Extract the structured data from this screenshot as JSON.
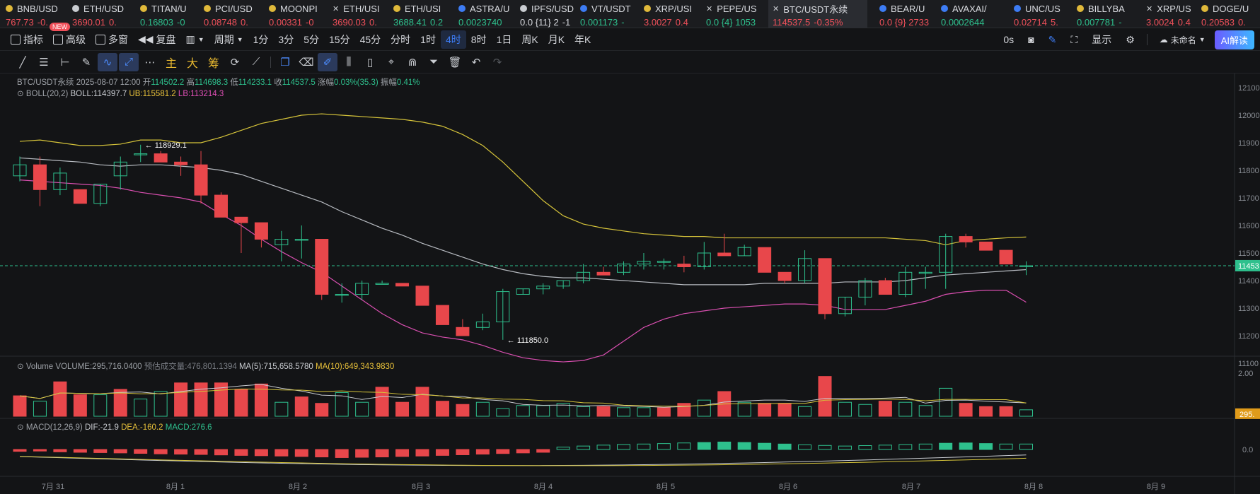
{
  "tickers": [
    {
      "sym": "BNB/USD",
      "icon": "coin-icon",
      "color": "#e0b93a",
      "val": "767.73",
      "chg": "-0.",
      "dir": "neg"
    },
    {
      "sym": "ETH/USD",
      "icon": "coin-icon",
      "color": "#c9ccd1",
      "val": "3690.01",
      "chg": "0.",
      "dir": "neg"
    },
    {
      "sym": "TITAN/U",
      "icon": "coin-icon",
      "color": "#e0b93a",
      "val": "0.16803",
      "chg": "-0",
      "dir": "pos"
    },
    {
      "sym": "PCI/USD",
      "icon": "coin-icon",
      "color": "#e0b93a",
      "val": "0.08748",
      "chg": "0.",
      "dir": "neg"
    },
    {
      "sym": "MOONPI",
      "icon": "coin-icon",
      "color": "#e0b93a",
      "val": "0.00331",
      "chg": "-0",
      "dir": "neg"
    },
    {
      "sym": "ETH/USI",
      "icon": "close-icon",
      "color": "#c9ccd1",
      "val": "3690.03",
      "chg": "0.",
      "dir": "neg"
    },
    {
      "sym": "ETH/USI",
      "icon": "coin-icon",
      "color": "#e0b93a",
      "val": "3688.41",
      "chg": "0.2",
      "dir": "pos"
    },
    {
      "sym": "ASTRA/U",
      "icon": "coin-icon",
      "color": "#3d7cf4",
      "val": "0.0023740",
      "chg": "",
      "dir": "pos"
    },
    {
      "sym": "IPFS/USD",
      "icon": "coin-icon",
      "color": "#c9ccd1",
      "val": "0.0 {11} 2",
      "chg": "-1",
      "dir": "neutral"
    },
    {
      "sym": "VT/USDT",
      "icon": "coin-icon",
      "color": "#3d7cf4",
      "val": "0.001173",
      "chg": "-",
      "dir": "pos"
    },
    {
      "sym": "XRP/USI",
      "icon": "coin-icon",
      "color": "#e0b93a",
      "val": "3.0027",
      "chg": "0.4",
      "dir": "neg"
    },
    {
      "sym": "PEPE/US",
      "icon": "close-icon",
      "color": "#c9ccd1",
      "val": "0.0 {4} 1053",
      "chg": "",
      "dir": "pos"
    },
    {
      "sym": "BTC/USDT永续",
      "icon": "close-icon",
      "color": "#c9ccd1",
      "val": "114537.5",
      "chg": "-0.35%",
      "dir": "neg"
    },
    {
      "sym": "BEAR/U",
      "icon": "coin-icon",
      "color": "#3d7cf4",
      "val": "0.0 {9} 2733",
      "chg": "",
      "dir": "neg"
    },
    {
      "sym": "AVAXAI/",
      "icon": "coin-icon",
      "color": "#3d7cf4",
      "val": "0.0002644",
      "chg": "",
      "dir": "pos"
    },
    {
      "sym": "UNC/US",
      "icon": "coin-icon",
      "color": "#3d7cf4",
      "val": "0.02714",
      "chg": "5.",
      "dir": "neg"
    },
    {
      "sym": "BILLYBA",
      "icon": "coin-icon",
      "color": "#e0b93a",
      "val": "0.007781",
      "chg": "-",
      "dir": "pos"
    },
    {
      "sym": "XRP/US",
      "icon": "close-icon",
      "color": "#c9ccd1",
      "val": "3.0024",
      "chg": "0.4",
      "dir": "neg"
    },
    {
      "sym": "DOGE/U",
      "icon": "coin-icon",
      "color": "#e0b93a",
      "val": "0.20583",
      "chg": "0.",
      "dir": "neg"
    }
  ],
  "badge_new": "NEW",
  "toolbar": {
    "indicator": "指标",
    "advanced": "高级",
    "multi_window": "多窗",
    "replay": "复盘",
    "period_label": "周期",
    "periods": [
      "1分",
      "3分",
      "5分",
      "15分",
      "45分",
      "分时",
      "1时",
      "4时",
      "8时",
      "1日",
      "周K",
      "月K",
      "年K"
    ],
    "active_period": "4时",
    "right_time": "0s",
    "display": "显示",
    "unnamed": "未命名",
    "ai": "AI解读"
  },
  "draw_tools": [
    "line-tool",
    "hline-tool",
    "ray-tool",
    "pencil-tool",
    "wave-tool",
    "trend-tool",
    "more-tool",
    "主",
    "大",
    "筹",
    "sync-tool",
    "ruler-tool",
    "copy-tool",
    "eraser-tool",
    "brush-tool",
    "candle-tool",
    "clipboard-tool",
    "measure-tool",
    "filter-tool",
    "trash-tool",
    "undo-tool",
    "redo-tool"
  ],
  "legend": {
    "symbol": "BTC/USDT永续",
    "datetime": "2025-08-07 12:00",
    "open_l": "开",
    "open": "114502.2",
    "high_l": "高",
    "high": "114698.3",
    "low_l": "低",
    "low": "114233.1",
    "close_l": "收",
    "close": "114537.5",
    "chg_l": "涨幅",
    "chg": "0.03%(35.3)",
    "amp_l": "振幅",
    "amp": "0.41%",
    "boll_name": "BOLL(20,2)",
    "boll": "BOLL:114397.7",
    "ub": "UB:115581.2",
    "lb": "LB:113214.3",
    "vol_name": "Volume",
    "vol": "VOLUME:295,716.0400",
    "vol_est": "预估成交量:476,801.1394",
    "ma5": "MA(5):715,658.5780",
    "ma10": "MA(10):649,343.9830",
    "macd_name": "MACD(12,26,9)",
    "dif": "DIF:-21.9",
    "dea": "DEA:-160.2",
    "macd": "MACD:276.6"
  },
  "annotations": {
    "high": "← 118929.1",
    "low": "← 111850.0"
  },
  "price_axis": [
    "12100",
    "12000",
    "11900",
    "11800",
    "11700",
    "11600",
    "11500",
    "11400",
    "11300",
    "11200",
    "11100"
  ],
  "current_price_label": "11453",
  "vol_axis": [
    "2.00"
  ],
  "vol_current_label": "295.",
  "macd_axis": [
    "0.0"
  ],
  "x_labels": [
    "7月 31",
    "8月 1",
    "8月 2",
    "8月 3",
    "8月 4",
    "8月 5",
    "8月 6",
    "8月 7",
    "8月 8",
    "8月 9"
  ],
  "colors": {
    "up": "#2ec08d",
    "down": "#e8474b",
    "ub": "#d6c43a",
    "mid": "#b8bcc2",
    "lb": "#d94fb0",
    "bg": "#131416"
  },
  "chart_data": {
    "type": "candlestick",
    "interval": "4时",
    "candles": [
      {
        "o": 117800,
        "h": 118500,
        "l": 117600,
        "c": 118200
      },
      {
        "o": 118200,
        "h": 118500,
        "l": 116700,
        "c": 117300
      },
      {
        "o": 117300,
        "h": 118100,
        "l": 117100,
        "c": 117900
      },
      {
        "o": 117300,
        "h": 117300,
        "l": 116800,
        "c": 116800
      },
      {
        "o": 116800,
        "h": 117500,
        "l": 116700,
        "c": 117500
      },
      {
        "o": 117800,
        "h": 118500,
        "l": 117300,
        "c": 118300
      },
      {
        "o": 118600,
        "h": 118929.1,
        "l": 118300,
        "c": 118600
      },
      {
        "o": 118600,
        "h": 118700,
        "l": 118400,
        "c": 118300
      },
      {
        "o": 118300,
        "h": 118500,
        "l": 117800,
        "c": 118200
      },
      {
        "o": 118200,
        "h": 118700,
        "l": 116800,
        "c": 117100
      },
      {
        "o": 117100,
        "h": 117200,
        "l": 116300,
        "c": 116300
      },
      {
        "o": 116300,
        "h": 116300,
        "l": 115000,
        "c": 116100
      },
      {
        "o": 116100,
        "h": 116100,
        "l": 115200,
        "c": 115500
      },
      {
        "o": 115300,
        "h": 115800,
        "l": 114700,
        "c": 115500
      },
      {
        "o": 115500,
        "h": 116000,
        "l": 114800,
        "c": 115500
      },
      {
        "o": 115500,
        "h": 115500,
        "l": 113300,
        "c": 113500
      },
      {
        "o": 113500,
        "h": 113900,
        "l": 113200,
        "c": 113500
      },
      {
        "o": 113500,
        "h": 114000,
        "l": 113300,
        "c": 113900
      },
      {
        "o": 113900,
        "h": 114000,
        "l": 113900,
        "c": 113900
      },
      {
        "o": 113900,
        "h": 113900,
        "l": 113800,
        "c": 113800
      },
      {
        "o": 113800,
        "h": 113800,
        "l": 113100,
        "c": 113100
      },
      {
        "o": 113100,
        "h": 113100,
        "l": 112400,
        "c": 112400
      },
      {
        "o": 112300,
        "h": 112600,
        "l": 112100,
        "c": 112000
      },
      {
        "o": 112300,
        "h": 112800,
        "l": 112200,
        "c": 112500
      },
      {
        "o": 112500,
        "h": 113700,
        "l": 111850,
        "c": 113600
      },
      {
        "o": 113500,
        "h": 113700,
        "l": 113500,
        "c": 113700
      },
      {
        "o": 113700,
        "h": 113900,
        "l": 113500,
        "c": 113800
      },
      {
        "o": 113800,
        "h": 114000,
        "l": 113700,
        "c": 114000
      },
      {
        "o": 114000,
        "h": 114600,
        "l": 113900,
        "c": 114300
      },
      {
        "o": 114300,
        "h": 114500,
        "l": 114200,
        "c": 114200
      },
      {
        "o": 114300,
        "h": 114700,
        "l": 114200,
        "c": 114600
      },
      {
        "o": 114600,
        "h": 115000,
        "l": 114400,
        "c": 114700
      },
      {
        "o": 114700,
        "h": 114800,
        "l": 114400,
        "c": 114700
      },
      {
        "o": 114600,
        "h": 114900,
        "l": 114300,
        "c": 114500
      },
      {
        "o": 114500,
        "h": 115400,
        "l": 114400,
        "c": 115000
      },
      {
        "o": 115000,
        "h": 115700,
        "l": 114900,
        "c": 114900
      },
      {
        "o": 114900,
        "h": 115300,
        "l": 114900,
        "c": 115200
      },
      {
        "o": 115200,
        "h": 115200,
        "l": 114300,
        "c": 114300
      },
      {
        "o": 114300,
        "h": 114300,
        "l": 113900,
        "c": 114000
      },
      {
        "o": 114000,
        "h": 115100,
        "l": 113900,
        "c": 114800
      },
      {
        "o": 114800,
        "h": 114800,
        "l": 112600,
        "c": 112800
      },
      {
        "o": 112800,
        "h": 113400,
        "l": 112700,
        "c": 113400
      },
      {
        "o": 113400,
        "h": 114100,
        "l": 113100,
        "c": 114000
      },
      {
        "o": 114000,
        "h": 114100,
        "l": 113500,
        "c": 113500
      },
      {
        "o": 113500,
        "h": 114500,
        "l": 113400,
        "c": 114300
      },
      {
        "o": 114300,
        "h": 114500,
        "l": 113700,
        "c": 114300
      },
      {
        "o": 114300,
        "h": 115700,
        "l": 113700,
        "c": 115600
      },
      {
        "o": 115600,
        "h": 115700,
        "l": 115200,
        "c": 115400
      },
      {
        "o": 115400,
        "h": 115400,
        "l": 115100,
        "c": 115100
      },
      {
        "o": 115100,
        "h": 115100,
        "l": 114600,
        "c": 114600
      },
      {
        "o": 114500,
        "h": 114700,
        "l": 114200,
        "c": 114540
      }
    ],
    "boll_ub": [
      119050,
      119100,
      119000,
      118900,
      118900,
      118950,
      119100,
      119100,
      119000,
      119000,
      119200,
      119450,
      119700,
      119850,
      120000,
      120050,
      120000,
      119950,
      119900,
      119850,
      119750,
      119600,
      119300,
      118900,
      118300,
      117600,
      116900,
      116350,
      116050,
      115900,
      115800,
      115700,
      115650,
      115600,
      115600,
      115550,
      115550,
      115550,
      115550,
      115550,
      115550,
      115550,
      115550,
      115550,
      115500,
      115450,
      115300,
      115450,
      115500,
      115550,
      115580
    ],
    "boll_mid": [
      118450,
      118400,
      118350,
      118300,
      118200,
      118150,
      118200,
      118200,
      118150,
      118100,
      118000,
      117850,
      117600,
      117350,
      117100,
      116850,
      116500,
      116200,
      115900,
      115650,
      115350,
      115100,
      114850,
      114600,
      114400,
      114250,
      114150,
      114100,
      114100,
      114050,
      114000,
      113950,
      113900,
      113850,
      113850,
      113850,
      113850,
      113900,
      113900,
      113900,
      113900,
      113950,
      113950,
      113950,
      114000,
      114100,
      114200,
      114250,
      114300,
      114350,
      114398
    ],
    "boll_lb": [
      117650,
      117600,
      117550,
      117500,
      117450,
      117350,
      117200,
      117100,
      117000,
      116850,
      116400,
      116000,
      115500,
      115050,
      114650,
      114300,
      113800,
      113300,
      112800,
      112400,
      112100,
      111950,
      111850,
      111650,
      111400,
      111200,
      111100,
      111050,
      111100,
      111300,
      111800,
      112300,
      112600,
      112800,
      112900,
      113000,
      113050,
      113100,
      113150,
      113150,
      113100,
      112950,
      112950,
      112950,
      113100,
      113250,
      113500,
      113600,
      113650,
      113650,
      113214
    ],
    "volume": [
      0.95,
      0.7,
      1.6,
      1.0,
      1.0,
      1.25,
      0.8,
      1.15,
      1.55,
      1.55,
      1.55,
      1.25,
      1.5,
      0.65,
      0.9,
      0.6,
      1.1,
      0.65,
      1.35,
      0.65,
      1.35,
      0.7,
      0.55,
      0.65,
      0.35,
      0.5,
      0.5,
      0.6,
      0.45,
      0.45,
      0.4,
      0.4,
      0.4,
      0.6,
      0.75,
      1.15,
      0.65,
      0.6,
      0.6,
      0.45,
      1.85,
      0.65,
      0.55,
      0.7,
      0.65,
      0.5,
      1.3,
      0.6,
      0.45,
      0.45,
      0.3
    ],
    "vol_dir": [
      "d",
      "u",
      "d",
      "d",
      "u",
      "d",
      "u",
      "u",
      "d",
      "d",
      "d",
      "d",
      "d",
      "u",
      "d",
      "d",
      "u",
      "u",
      "d",
      "d",
      "d",
      "d",
      "d",
      "u",
      "u",
      "u",
      "u",
      "u",
      "u",
      "d",
      "u",
      "u",
      "d",
      "d",
      "u",
      "d",
      "u",
      "d",
      "d",
      "u",
      "d",
      "u",
      "u",
      "d",
      "u",
      "u",
      "u",
      "d",
      "d",
      "d",
      "u"
    ],
    "macd_hist": [
      -12,
      -10,
      -15,
      -18,
      -20,
      -22,
      -25,
      -28,
      -30,
      -32,
      -35,
      -38,
      -40,
      -42,
      -45,
      -48,
      -52,
      -50,
      -48,
      -45,
      -42,
      -38,
      -34,
      -30,
      -26,
      -22,
      -18,
      15,
      22,
      28,
      32,
      35,
      38,
      42,
      45,
      48,
      45,
      40,
      35,
      30,
      26,
      22,
      25,
      28,
      32,
      35,
      40,
      42,
      38,
      35,
      35
    ]
  }
}
